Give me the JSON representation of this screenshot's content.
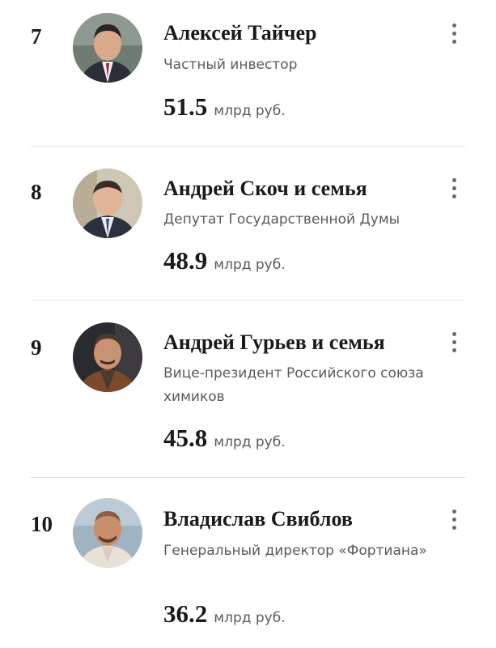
{
  "entries": [
    {
      "rank": "7",
      "name": "Алексей Тайчер",
      "role": "Частный инвестор",
      "wealth": "51.5",
      "unit": "млрд руб."
    },
    {
      "rank": "8",
      "name": "Андрей Скоч и семья",
      "role": "Депутат Государственной Думы",
      "wealth": "48.9",
      "unit": "млрд руб."
    },
    {
      "rank": "9",
      "name": "Андрей Гурьев и семья",
      "role": "Вице-президент Российского союза химиков",
      "wealth": "45.8",
      "unit": "млрд руб."
    },
    {
      "rank": "10",
      "name": "Владислав Свиблов",
      "role": "Генеральный директор «Фортиана»",
      "wealth": "36.2",
      "unit": "млрд руб."
    }
  ],
  "icons": {
    "menu": "more-vertical-icon",
    "avatar": "person-photo"
  }
}
